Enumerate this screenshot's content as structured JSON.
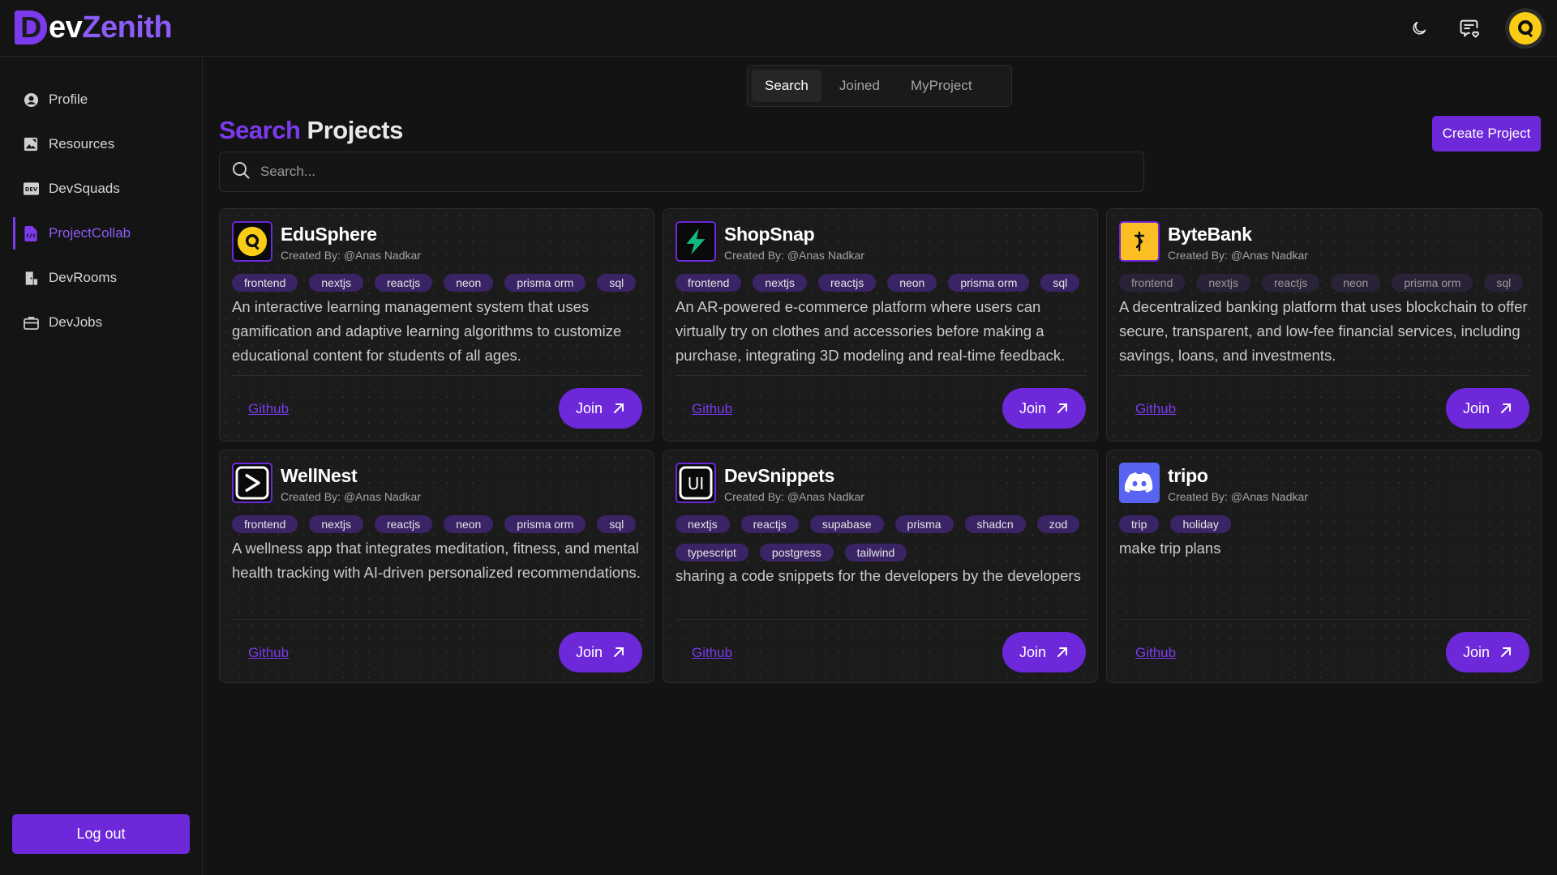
{
  "app": {
    "logo_letter": "D",
    "logo_rest": "ev",
    "logo_accent": "Zenith"
  },
  "colors": {
    "accent": "#7c3aed",
    "accent_button": "#6d28d9",
    "background": "#131313"
  },
  "header_icons": [
    "moon-icon",
    "chat-heart-icon",
    "avatar"
  ],
  "sidebar": {
    "items": [
      {
        "label": "Profile",
        "icon": "user-circle-icon"
      },
      {
        "label": "Resources",
        "icon": "image-edit-icon"
      },
      {
        "label": "DevSquads",
        "icon": "dev-badge-icon"
      },
      {
        "label": "ProjectCollab",
        "icon": "file-code-icon",
        "active": true
      },
      {
        "label": "DevRooms",
        "icon": "door-icon"
      },
      {
        "label": "DevJobs",
        "icon": "briefcase-icon"
      }
    ],
    "logout_label": "Log out"
  },
  "tabs": [
    {
      "label": "Search",
      "active": true
    },
    {
      "label": "Joined"
    },
    {
      "label": "MyProject"
    }
  ],
  "page": {
    "title_accent": "Search",
    "title_rest": "Projects",
    "create_label": "Create Project",
    "search_placeholder": "Search..."
  },
  "projects": [
    {
      "name": "EduSphere",
      "author": "Created By: @Anas Nadkar",
      "tags": [
        "frontend",
        "nextjs",
        "reactjs",
        "neon",
        "prisma orm",
        "sql"
      ],
      "description": "An interactive learning management system that uses gamification and adaptive learning algorithms to customize educational content for students of all ages.",
      "github_label": "Github",
      "join_label": "Join"
    },
    {
      "name": "ShopSnap",
      "author": "Created By: @Anas Nadkar",
      "tags": [
        "frontend",
        "nextjs",
        "reactjs",
        "neon",
        "prisma orm",
        "sql"
      ],
      "description": "An AR-powered e-commerce platform where users can virtually try on clothes and accessories before making a purchase, integrating 3D modeling and real-time feedback.",
      "github_label": "Github",
      "join_label": "Join"
    },
    {
      "name": "ByteBank",
      "author": "Created By: @Anas Nadkar",
      "tags": [
        "frontend",
        "nextjs",
        "reactjs",
        "neon",
        "prisma orm",
        "sql"
      ],
      "description": "A decentralized banking platform that uses blockchain to offer secure, transparent, and low-fee financial services, including savings, loans, and investments.",
      "github_label": "Github",
      "join_label": "Join"
    },
    {
      "name": "WellNest",
      "author": "Created By: @Anas Nadkar",
      "tags": [
        "frontend",
        "nextjs",
        "reactjs",
        "neon",
        "prisma orm",
        "sql"
      ],
      "description": "A wellness app that integrates meditation, fitness, and mental health tracking with AI-driven personalized recommendations.",
      "github_label": "Github",
      "join_label": "Join"
    },
    {
      "name": "DevSnippets",
      "author": "Created By: @Anas Nadkar",
      "tags": [
        "nextjs",
        "reactjs",
        "supabase",
        "prisma",
        "shadcn",
        "zod",
        "typescript",
        "postgress",
        "tailwind"
      ],
      "description": "sharing a code snippets for the developers by the developers",
      "github_label": "Github",
      "join_label": "Join"
    },
    {
      "name": "tripo",
      "author": "Created By: @Anas Nadkar",
      "tags": [
        "trip",
        "holiday"
      ],
      "description": "make trip plans",
      "github_label": "Github",
      "join_label": "Join"
    }
  ]
}
